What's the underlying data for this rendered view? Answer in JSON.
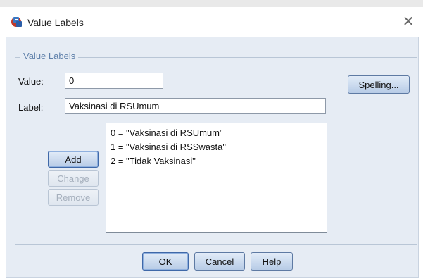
{
  "window": {
    "title": "Value Labels",
    "close_glyph": "✕"
  },
  "group": {
    "title": "Value Labels"
  },
  "value_field": {
    "label": "Value:",
    "value": "0"
  },
  "label_field": {
    "label": "Label:",
    "value": "Vaksinasi di RSUmum"
  },
  "buttons": {
    "spelling": "Spelling...",
    "add": "Add",
    "change": "Change",
    "remove": "Remove",
    "ok": "OK",
    "cancel": "Cancel",
    "help": "Help"
  },
  "labels_list": [
    "0 = \"Vaksinasi di RSUmum\"",
    "1 = \"Vaksinasi di RSSwasta\"",
    "2 = \"Tidak Vaksinasi\""
  ],
  "colors": {
    "accent": "#5f80aa",
    "client_bg": "#e6ecf4"
  }
}
